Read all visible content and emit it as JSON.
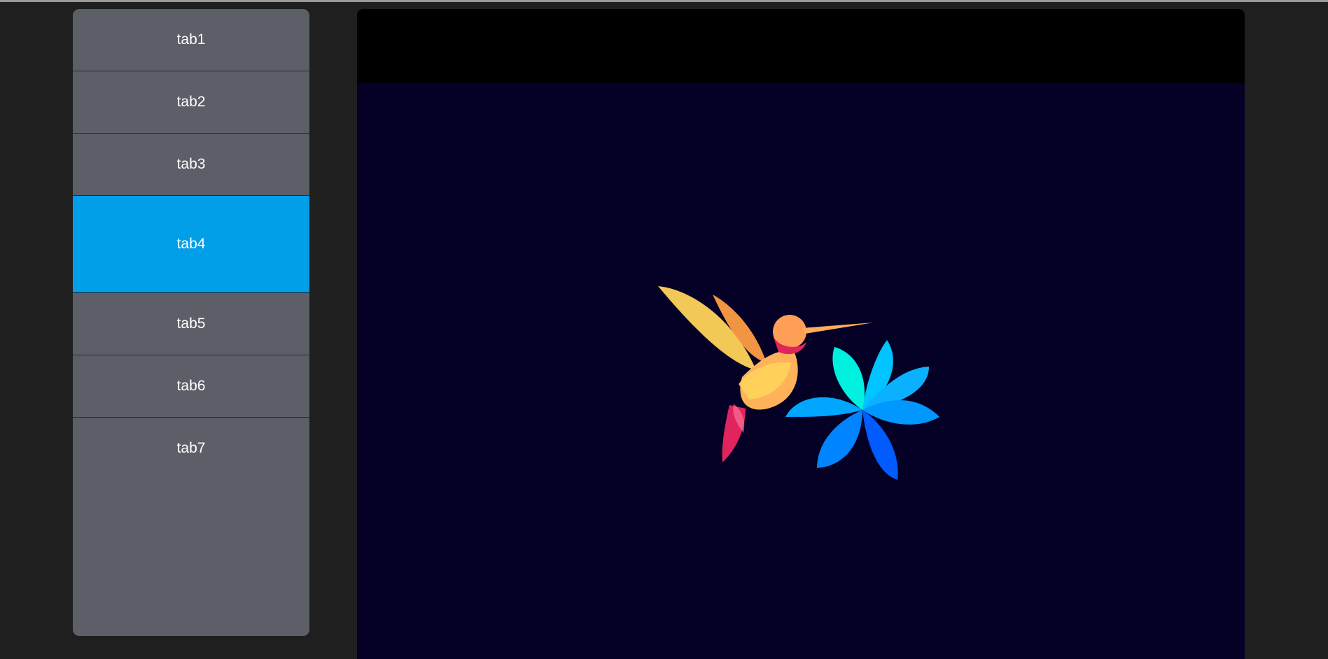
{
  "sidebar": {
    "tabs": [
      {
        "label": "tab1"
      },
      {
        "label": "tab2"
      },
      {
        "label": "tab3"
      },
      {
        "label": "tab4"
      },
      {
        "label": "tab5"
      },
      {
        "label": "tab6"
      },
      {
        "label": "tab7"
      }
    ],
    "active_index": 3
  },
  "colors": {
    "background": "#1f1f1f",
    "sidebar": "#5c5f68",
    "active_tab": "#009fe8",
    "content_header": "#000000",
    "content_body": "#050025"
  },
  "content": {
    "image": "hummingbird-flower-illustration"
  }
}
